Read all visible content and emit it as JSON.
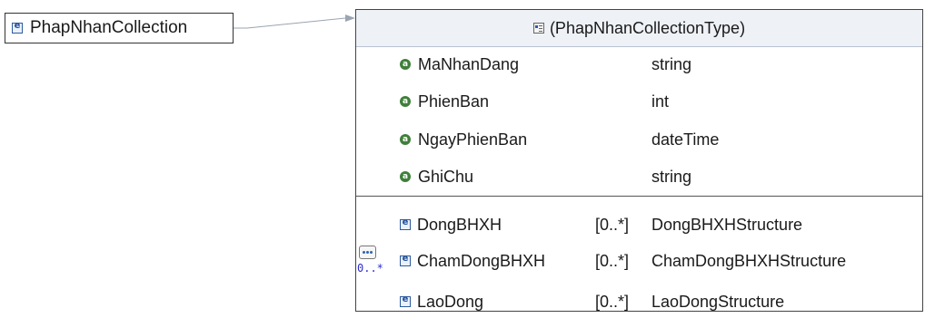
{
  "root_element": {
    "name": "PhapNhanCollection",
    "icon": "element-icon"
  },
  "complex_type": {
    "header": "(PhapNhanCollectionType)",
    "icon": "complex-type-icon",
    "attributes": [
      {
        "name": "MaNhanDang",
        "type": "string"
      },
      {
        "name": "PhienBan",
        "type": "int"
      },
      {
        "name": "NgayPhienBan",
        "type": "dateTime"
      },
      {
        "name": "GhiChu",
        "type": "string"
      }
    ],
    "sequence": {
      "icon": "sequence-icon",
      "multiplicity": "0..*",
      "elements": [
        {
          "name": "DongBHXH",
          "multiplicity": "[0..*]",
          "type": "DongBHXHStructure"
        },
        {
          "name": "ChamDongBHXH",
          "multiplicity": "[0..*]",
          "type": "ChamDongBHXHStructure"
        },
        {
          "name": "LaoDong",
          "multiplicity": "[0..*]",
          "type": "LaoDongStructure"
        }
      ]
    }
  },
  "colors": {
    "element_icon": "#1f4f96",
    "attribute_icon": "#3f7f3a",
    "sequence_multiplicity": "#2b2bd0"
  }
}
